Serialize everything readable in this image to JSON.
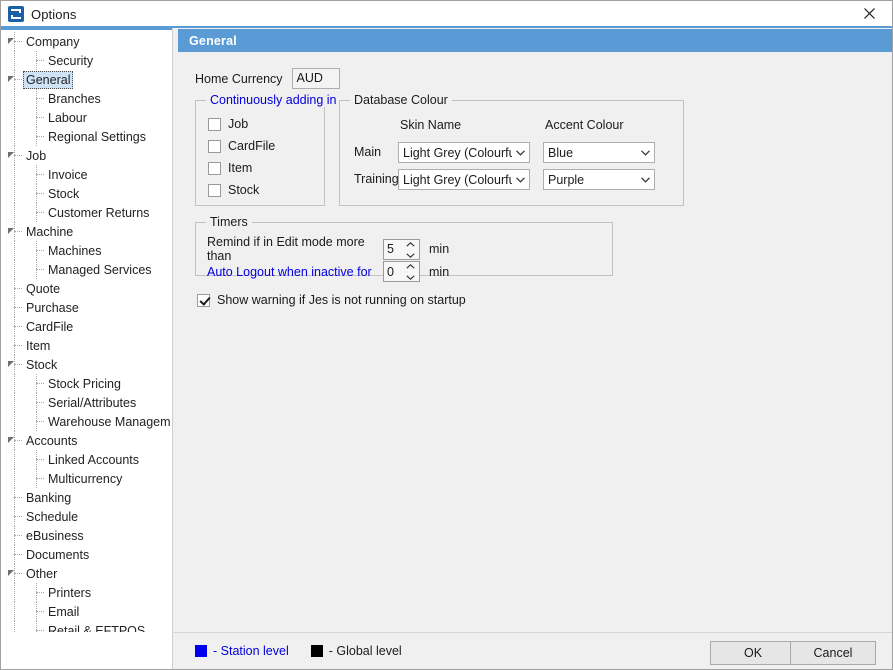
{
  "window": {
    "title": "Options",
    "icon": "app-logo-icon",
    "close_label": "✕"
  },
  "sidebar": {
    "items": [
      {
        "label": "Company",
        "level": 0,
        "expandable": true,
        "selected": false
      },
      {
        "label": "Security",
        "level": 1,
        "expandable": false,
        "selected": false
      },
      {
        "label": "General",
        "level": 0,
        "expandable": true,
        "selected": true
      },
      {
        "label": "Branches",
        "level": 1,
        "expandable": false,
        "selected": false
      },
      {
        "label": "Labour",
        "level": 1,
        "expandable": false,
        "selected": false
      },
      {
        "label": "Regional Settings",
        "level": 1,
        "expandable": false,
        "selected": false
      },
      {
        "label": "Job",
        "level": 0,
        "expandable": true,
        "selected": false
      },
      {
        "label": "Invoice",
        "level": 1,
        "expandable": false,
        "selected": false
      },
      {
        "label": "Stock",
        "level": 1,
        "expandable": false,
        "selected": false
      },
      {
        "label": "Customer Returns",
        "level": 1,
        "expandable": false,
        "selected": false
      },
      {
        "label": "Machine",
        "level": 0,
        "expandable": true,
        "selected": false
      },
      {
        "label": "Machines",
        "level": 1,
        "expandable": false,
        "selected": false
      },
      {
        "label": "Managed Services",
        "level": 1,
        "expandable": false,
        "selected": false
      },
      {
        "label": "Quote",
        "level": 0,
        "expandable": false,
        "selected": false
      },
      {
        "label": "Purchase",
        "level": 0,
        "expandable": false,
        "selected": false
      },
      {
        "label": "CardFile",
        "level": 0,
        "expandable": false,
        "selected": false
      },
      {
        "label": "Item",
        "level": 0,
        "expandable": false,
        "selected": false
      },
      {
        "label": "Stock",
        "level": 0,
        "expandable": true,
        "selected": false
      },
      {
        "label": "Stock Pricing",
        "level": 1,
        "expandable": false,
        "selected": false
      },
      {
        "label": "Serial/Attributes",
        "level": 1,
        "expandable": false,
        "selected": false
      },
      {
        "label": "Warehouse Management",
        "level": 1,
        "expandable": false,
        "selected": false
      },
      {
        "label": "Accounts",
        "level": 0,
        "expandable": true,
        "selected": false
      },
      {
        "label": "Linked Accounts",
        "level": 1,
        "expandable": false,
        "selected": false
      },
      {
        "label": "Multicurrency",
        "level": 1,
        "expandable": false,
        "selected": false
      },
      {
        "label": "Banking",
        "level": 0,
        "expandable": false,
        "selected": false
      },
      {
        "label": "Schedule",
        "level": 0,
        "expandable": false,
        "selected": false
      },
      {
        "label": "eBusiness",
        "level": 0,
        "expandable": false,
        "selected": false
      },
      {
        "label": "Documents",
        "level": 0,
        "expandable": false,
        "selected": false
      },
      {
        "label": "Other",
        "level": 0,
        "expandable": true,
        "selected": false
      },
      {
        "label": "Printers",
        "level": 1,
        "expandable": false,
        "selected": false
      },
      {
        "label": "Email",
        "level": 1,
        "expandable": false,
        "selected": false
      },
      {
        "label": "Retail & EFTPOS",
        "level": 1,
        "expandable": false,
        "selected": false
      }
    ]
  },
  "panel": {
    "header_title": "General",
    "home_currency": {
      "label": "Home Currency",
      "value": "AUD"
    },
    "continuously_adding": {
      "legend": "Continuously adding in",
      "level": "station",
      "options": [
        {
          "label": "Job",
          "checked": false
        },
        {
          "label": "CardFile",
          "checked": false
        },
        {
          "label": "Item",
          "checked": false
        },
        {
          "label": "Stock",
          "checked": false
        }
      ]
    },
    "database_colour": {
      "legend": "Database Colour",
      "column_headers": [
        "Skin Name",
        "Accent Colour"
      ],
      "rows": [
        {
          "row_label": "Main",
          "skin_name": "Light Grey (Colourful)",
          "accent_colour": "Blue"
        },
        {
          "row_label": "Training",
          "skin_name": "Light Grey (Colourful)",
          "accent_colour": "Purple"
        }
      ]
    },
    "timers": {
      "legend": "Timers",
      "rows": [
        {
          "label": "Remind if in Edit mode more than",
          "value": "5",
          "unit": "min",
          "level": "global"
        },
        {
          "label": "Auto Logout when inactive for",
          "value": "0",
          "unit": "min",
          "level": "station"
        }
      ]
    },
    "startup_warning": {
      "label": "Show warning if Jes is not running on startup",
      "checked": true
    }
  },
  "footer": {
    "legend": [
      {
        "swatch": "station",
        "text": "- Station level",
        "color": "#0000dd"
      },
      {
        "swatch": "global",
        "text": "- Global level",
        "color": "#1b1b1b"
      }
    ],
    "ok_label": "OK",
    "cancel_label": "Cancel"
  },
  "colors": {
    "accent": "#5b9bd5",
    "station": "#0000dd",
    "global": "#000000",
    "selection": "#cfe3f7"
  }
}
